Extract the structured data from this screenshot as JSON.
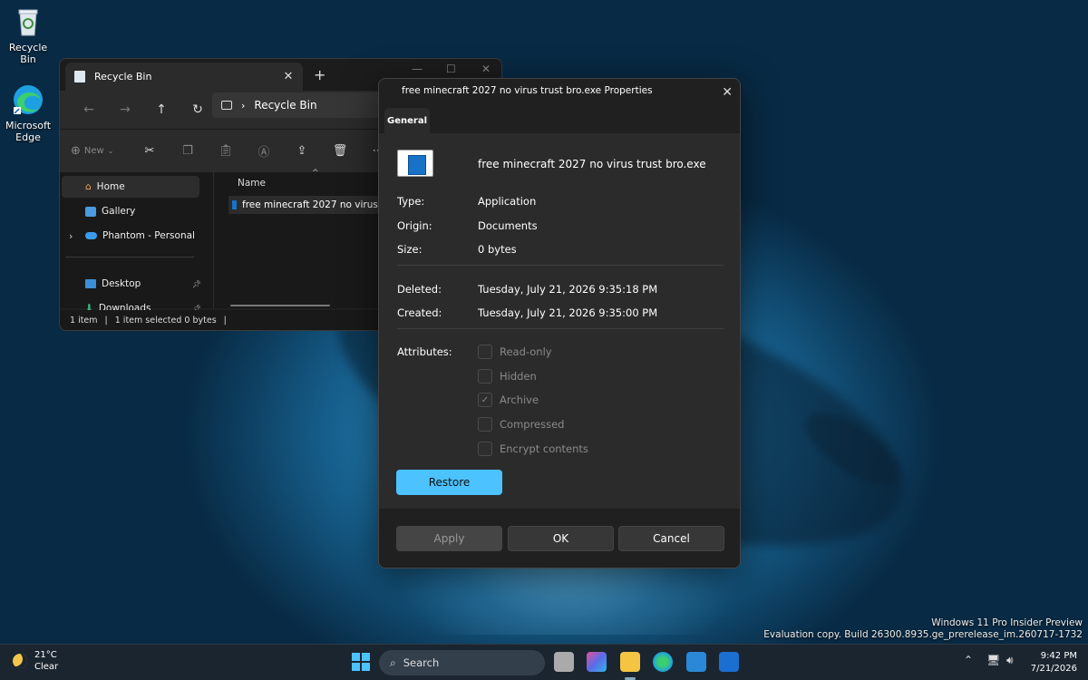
{
  "desktop": {
    "icons": [
      {
        "label": "Recycle Bin",
        "icon": "recycle-bin-icon"
      },
      {
        "label": "Microsoft Edge",
        "icon": "edge-icon"
      }
    ],
    "watermark": {
      "line1": "Windows 11 Pro Insider Preview",
      "line2": "Evaluation copy. Build 26300.8935.ge_prerelease_im.260717-1732"
    }
  },
  "explorer": {
    "tab_title": "Recycle Bin",
    "address": "Recycle Bin",
    "new_label": "New",
    "sidebar": [
      {
        "label": "Home",
        "icon": "home-icon",
        "selected": true
      },
      {
        "label": "Gallery",
        "icon": "gallery-icon"
      },
      {
        "label": "Phantom - Personal",
        "icon": "onedrive-icon"
      },
      {
        "label": "Desktop",
        "icon": "desktop-folder-icon",
        "pinned": true
      },
      {
        "label": "Downloads",
        "icon": "downloads-icon",
        "pinned": true
      }
    ],
    "column_header": "Name",
    "file_row": "free minecraft 2027 no virus trust bro.exe",
    "status": {
      "count": "1 item",
      "selected": "1 item selected  0 bytes"
    }
  },
  "properties": {
    "title": "free minecraft 2027 no virus trust bro.exe Properties",
    "tab": "General",
    "file_name": "free minecraft 2027 no virus trust bro.exe",
    "type_label": "Type:",
    "type_value": "Application",
    "origin_label": "Origin:",
    "origin_value": "Documents",
    "size_label": "Size:",
    "size_value": "0 bytes",
    "deleted_label": "Deleted:",
    "deleted_value": "Tuesday, July 21, 2026 9:35:18 PM",
    "created_label": "Created:",
    "created_value": "Tuesday, July 21, 2026 9:35:00 PM",
    "attributes_label": "Attributes:",
    "attributes": [
      {
        "label": "Read-only",
        "checked": false
      },
      {
        "label": "Hidden",
        "checked": false
      },
      {
        "label": "Archive",
        "checked": true
      },
      {
        "label": "Compressed",
        "checked": false
      },
      {
        "label": "Encrypt contents",
        "checked": false
      }
    ],
    "restore_label": "Restore",
    "apply_label": "Apply",
    "ok_label": "OK",
    "cancel_label": "Cancel",
    "accent_color": "#4cc2ff"
  },
  "taskbar": {
    "weather_temp": "21°C",
    "weather_desc": "Clear",
    "search_placeholder": "Search",
    "time": "9:42 PM",
    "date": "7/21/2026"
  }
}
